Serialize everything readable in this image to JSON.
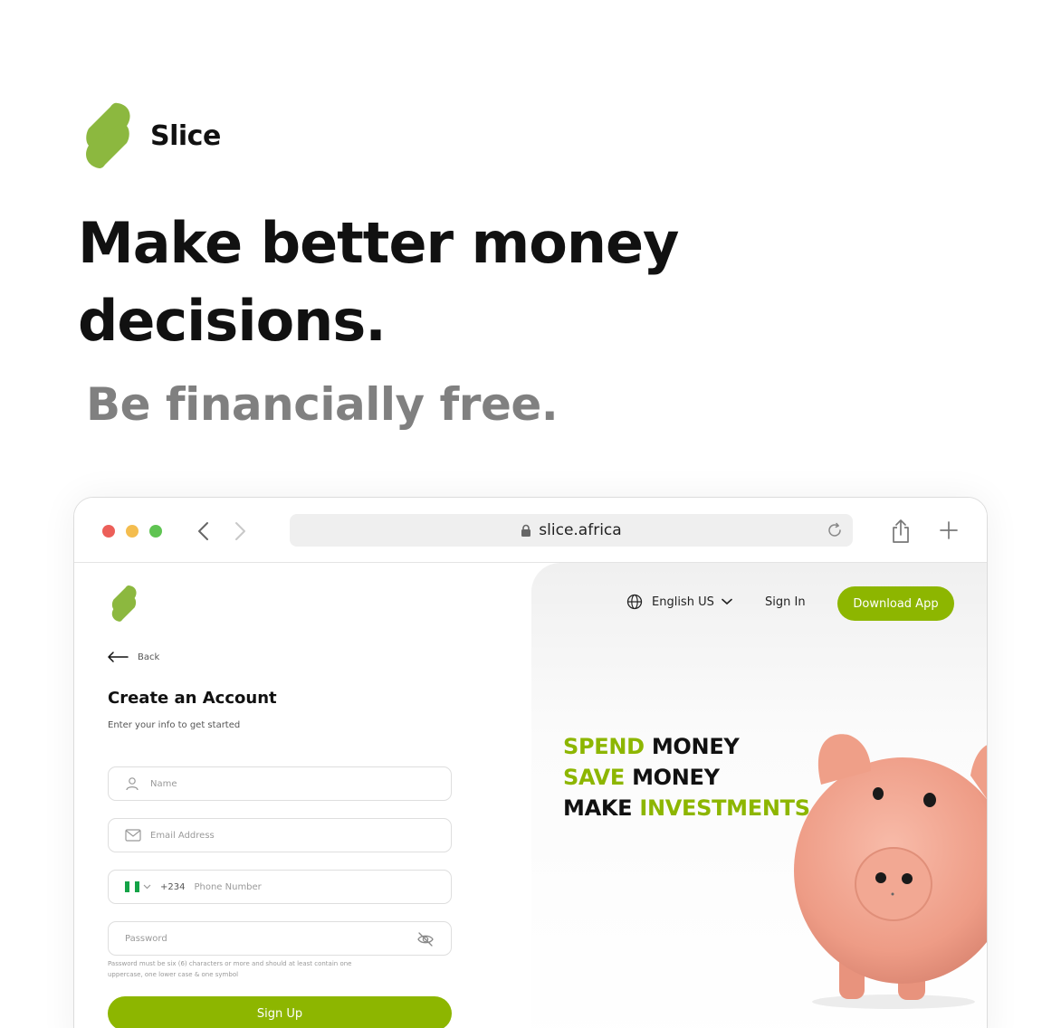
{
  "brand": {
    "name": "Slice",
    "logo_icon": "slice-logo-icon",
    "color": "#8db600"
  },
  "hero": {
    "headline_line1": "Make better money",
    "headline_line2": "decisions.",
    "tagline": "Be financially free."
  },
  "browser": {
    "url": "slice.africa",
    "icons": [
      "back-arrow-icon",
      "forward-arrow-icon",
      "lock-icon",
      "reload-icon",
      "share-icon",
      "new-tab-icon"
    ]
  },
  "signup_page": {
    "back_label": "Back",
    "title": "Create an Account",
    "subtitle": "Enter your info to get started",
    "name_placeholder": "Name",
    "email_placeholder": "Email Address",
    "phone_prefix": "+234",
    "phone_placeholder": "Phone Number",
    "password_placeholder": "Password",
    "password_hint": "Password must be six (6) characters or more and should at least contain one uppercase, one lower case & one symbol",
    "submit_label": "Sign Up"
  },
  "right_panel": {
    "language": "English US",
    "signin_label": "Sign In",
    "download_label": "Download App",
    "slogan": {
      "line1_green": "SPEND",
      "line1_black": "MONEY",
      "line2_green": "SAVE",
      "line2_black": "MONEY",
      "line3_black": "MAKE",
      "line3_green": "INVESTMENTS"
    }
  },
  "colors": {
    "accent": "#8db600",
    "muted_text": "#808080",
    "pig": "#f2a593"
  }
}
